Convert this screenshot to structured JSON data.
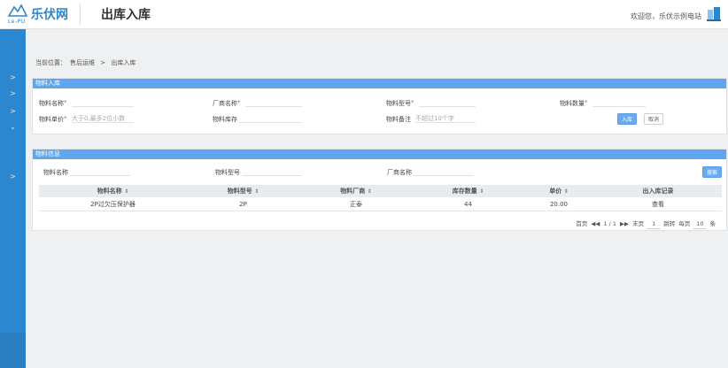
{
  "header": {
    "logo_text": "乐伏网",
    "logo_sub": "Le-PU",
    "page_title": "出库入库",
    "welcome": "欢迎您，乐伏示例电站"
  },
  "sidebar": {
    "items": [
      ">",
      ">",
      ">",
      "⌄",
      ">"
    ]
  },
  "breadcrumb": {
    "label": "当前位置：",
    "parent": "售后运维",
    "sep": ">",
    "current": "出库入库"
  },
  "stock_in": {
    "title": "物料入库",
    "fields": {
      "name": "物料名称",
      "vendor": "厂商名称",
      "model": "物料型号",
      "qty": "物料数量",
      "price": "物料单价",
      "price_placeholder": "大于0,最多2位小数",
      "stock": "物料库存",
      "remark": "物料备注",
      "remark_placeholder": "不超过10个字"
    },
    "submit": "入库",
    "cancel": "取消"
  },
  "info": {
    "title": "物料信息",
    "filters": {
      "name": "物料名称",
      "model": "物料型号",
      "vendor": "厂商名称"
    },
    "search": "搜索",
    "columns": [
      "物料名称",
      "物料型号",
      "物料厂商",
      "库存数量",
      "单价",
      "出入库记录"
    ],
    "sort_glyph": "⇕",
    "rows": [
      {
        "name": "2P过欠压保护器",
        "model": "2P",
        "vendor": "正泰",
        "stock": "44",
        "price": "20.00",
        "action": "查看"
      }
    ],
    "pager": {
      "first": "首页",
      "prev": "◀◀",
      "page": "1",
      "slash": "/",
      "total": "1",
      "next": "▶▶",
      "last": "末页",
      "jump_value": "1",
      "jump": "跳转",
      "per_page_label": "每页",
      "per_page": "10",
      "unit": "条"
    }
  },
  "colors": {
    "brand": "#2e86c9",
    "panel_head": "#5fa6f1",
    "sidebar": "#2b87cf",
    "required": "#e0522f"
  }
}
